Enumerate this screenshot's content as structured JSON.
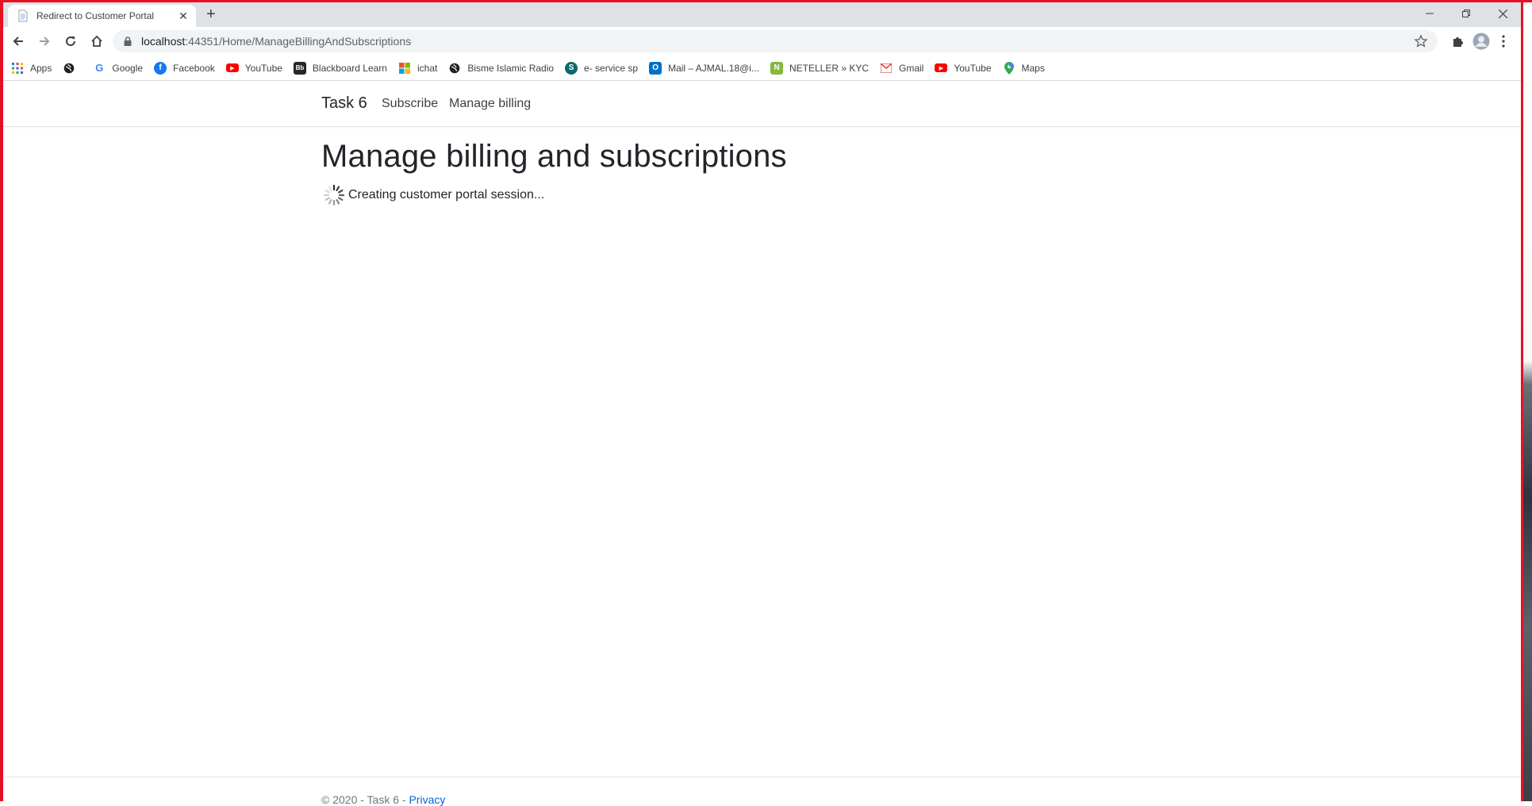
{
  "browser": {
    "tab_title": "Redirect to Customer Portal",
    "url_host": "localhost",
    "url_path": ":44351/Home/ManageBillingAndSubscriptions"
  },
  "bookmarks": [
    {
      "label": "Apps",
      "icon": "apps-grid-icon"
    },
    {
      "label": "",
      "icon": "globe-icon"
    },
    {
      "label": "Google",
      "icon": "google-icon"
    },
    {
      "label": "Facebook",
      "icon": "facebook-icon"
    },
    {
      "label": "YouTube",
      "icon": "youtube-icon"
    },
    {
      "label": "Blackboard Learn",
      "icon": "blackboard-icon"
    },
    {
      "label": "ichat",
      "icon": "windows-icon"
    },
    {
      "label": "Bisme Islamic Radio",
      "icon": "globe-icon"
    },
    {
      "label": "e- service sp",
      "icon": "sharepoint-icon"
    },
    {
      "label": "Mail – AJMAL.18@i...",
      "icon": "outlook-icon"
    },
    {
      "label": "NETELLER » KYC",
      "icon": "neteller-icon"
    },
    {
      "label": "Gmail",
      "icon": "gmail-icon"
    },
    {
      "label": "YouTube",
      "icon": "youtube-icon"
    },
    {
      "label": "Maps",
      "icon": "maps-icon"
    }
  ],
  "site": {
    "brand": "Task 6",
    "nav": [
      "Subscribe",
      "Manage billing"
    ],
    "heading": "Manage billing and subscriptions",
    "status": "Creating customer portal session...",
    "footer_prefix": "© 2020 - Task 6 - ",
    "footer_link": "Privacy"
  },
  "colors": {
    "frame": "#e81123",
    "link": "#0366d6"
  }
}
